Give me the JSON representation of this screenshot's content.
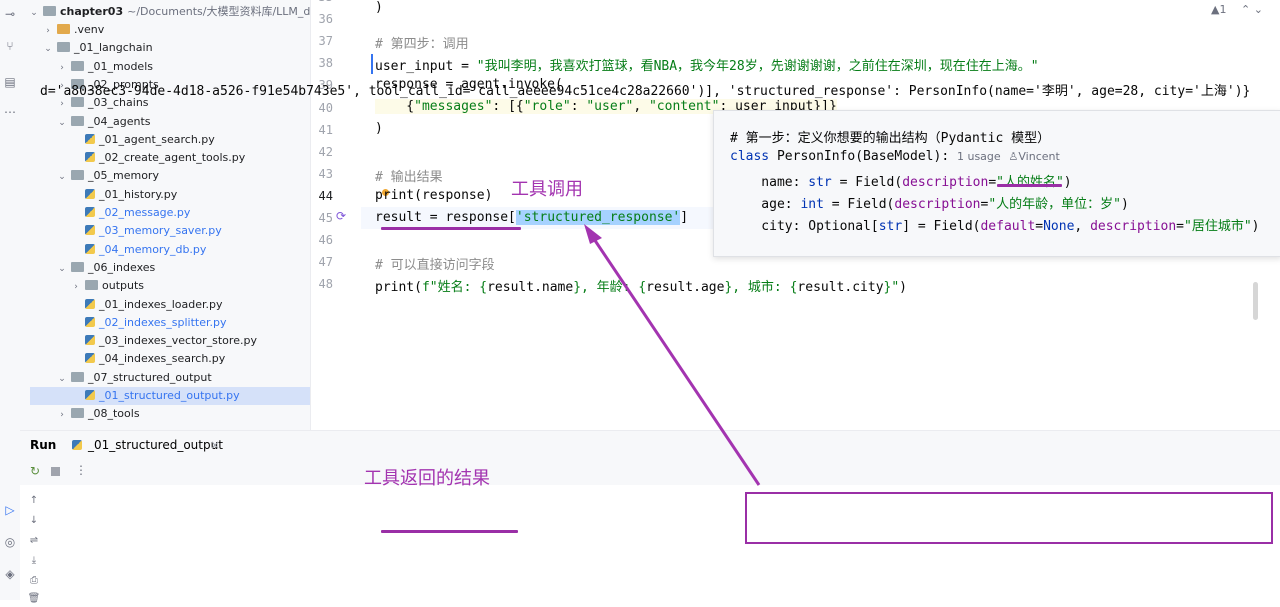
{
  "project_root": {
    "name": "chapter03",
    "path": "~/Documents/大模型资料库/LLM_dev/c"
  },
  "tree": [
    {
      "label": ".venv",
      "type": "folder-excluded",
      "indent": 1,
      "open": false
    },
    {
      "label": "_01_langchain",
      "type": "folder",
      "indent": 1,
      "open": true
    },
    {
      "label": "_01_models",
      "type": "folder",
      "indent": 2,
      "open": false
    },
    {
      "label": "_02_prompts",
      "type": "folder",
      "indent": 2,
      "open": false
    },
    {
      "label": "_03_chains",
      "type": "folder",
      "indent": 2,
      "open": false
    },
    {
      "label": "_04_agents",
      "type": "folder",
      "indent": 2,
      "open": true
    },
    {
      "label": "_01_agent_search.py",
      "type": "py",
      "indent": 3
    },
    {
      "label": "_02_create_agent_tools.py",
      "type": "py",
      "indent": 3
    },
    {
      "label": "_05_memory",
      "type": "folder",
      "indent": 2,
      "open": true
    },
    {
      "label": "_01_history.py",
      "type": "py",
      "indent": 3
    },
    {
      "label": "_02_message.py",
      "type": "py-modified",
      "indent": 3
    },
    {
      "label": "_03_memory_saver.py",
      "type": "py-modified",
      "indent": 3
    },
    {
      "label": "_04_memory_db.py",
      "type": "py-modified",
      "indent": 3
    },
    {
      "label": "_06_indexes",
      "type": "folder",
      "indent": 2,
      "open": true
    },
    {
      "label": "outputs",
      "type": "folder",
      "indent": 3,
      "open": false
    },
    {
      "label": "_01_indexes_loader.py",
      "type": "py",
      "indent": 3
    },
    {
      "label": "_02_indexes_splitter.py",
      "type": "py-modified",
      "indent": 3
    },
    {
      "label": "_03_indexes_vector_store.py",
      "type": "py",
      "indent": 3
    },
    {
      "label": "_04_indexes_search.py",
      "type": "py",
      "indent": 3
    },
    {
      "label": "_07_structured_output",
      "type": "folder",
      "indent": 2,
      "open": true
    },
    {
      "label": "_01_structured_output.py",
      "type": "py-selected",
      "indent": 3
    },
    {
      "label": "_08_tools",
      "type": "folder",
      "indent": 2,
      "open": false
    }
  ],
  "editor": {
    "line_numbers": [
      "35",
      "36",
      "37",
      "38",
      "39",
      "40",
      "41",
      "42",
      "43",
      "44",
      "45",
      "46",
      "47",
      "48"
    ],
    "current_line": "44",
    "lines": {
      "l35": ")",
      "l36": "# 第四步：调用",
      "l37_a": "user_input = ",
      "l37_b": "\"我叫李明，我喜欢打篮球，看NBA，我今年28岁，先谢谢谢谢，之前住在深圳，现在住在上海。\"",
      "l38": "response = agent.invoke(",
      "l39_a": "    {",
      "l39_b": "\"messages\"",
      "l39_c": ": [{",
      "l39_d": "\"role\"",
      "l39_e": ": ",
      "l39_f": "\"user\"",
      "l39_g": ", ",
      "l39_h": "\"content\"",
      "l39_i": ": user_input}]}",
      "l40": ")",
      "l42": "# 输出结果",
      "l43": "print(response)",
      "l44_a": "result = response[",
      "l44_b": "'structured_response'",
      "l44_c": "]",
      "l46": "# 可以直接访问字段",
      "l47_a": "print(",
      "l47_b": "f\"姓名: {",
      "l47_c": "result.name",
      "l47_d": "}, 年龄: {",
      "l47_e": "result.age",
      "l47_f": "}, 城市: {",
      "l47_g": "result.city",
      "l47_h": "}\"",
      "l47_i": ")"
    },
    "top_right": {
      "warnings": "▲1",
      "nav": "⌃ ⌄"
    }
  },
  "popup": {
    "comment": "# 第一步：定义你想要的输出结构（Pydantic 模型）",
    "class_kw": "class",
    "class_sig": " PersonInfo(BaseModel):",
    "usage": "1 usage",
    "author": "Vincent",
    "name_line_a": "    name: ",
    "name_line_b": "str",
    "name_line_c": " = Field(",
    "name_line_d": "description",
    "name_line_e": "=",
    "name_line_f": "\"人的姓名\"",
    "name_line_g": ")",
    "age_line_a": "    age: ",
    "age_line_b": "int",
    "age_line_c": " = Field(",
    "age_line_d": "description",
    "age_line_e": "=",
    "age_line_f": "\"人的年龄，单位：岁\"",
    "age_line_g": ")",
    "city_line_a": "    city: Optional[",
    "city_line_b": "str",
    "city_line_c": "] = Field(",
    "city_line_d": "default",
    "city_line_e": "=",
    "city_line_f": "None",
    "city_line_g": ", ",
    "city_line_h": "description",
    "city_line_i": "=",
    "city_line_j": "\"居住城市\"",
    "city_line_k": ")"
  },
  "run_panel": {
    "title": "Run",
    "tab_label": "_01_structured_output",
    "output_line": "d='a8038ec3-94de-4d18-a526-f91e54b743e5', tool_call_id='call_aeeee94c51ce4c28a22660')], 'structured_response': PersonInfo(name='李明', age=28, city='上海')}"
  },
  "annotations": {
    "tool_call": "工具调用",
    "tool_result": "工具返回的结果"
  },
  "colors": {
    "annotation": "#a334b0",
    "highlight": "#a6d2ff",
    "string": "#067d17",
    "keyword": "#0033b3",
    "kwarg": "#871094"
  }
}
